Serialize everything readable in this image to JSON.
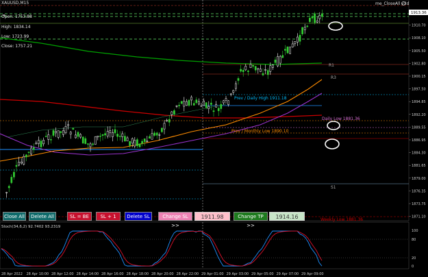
{
  "window": {
    "symbol": "XAUUSD,M15",
    "indicator_name": "me_CloseAll v3d",
    "subwindow_label": "Stoch(34,6,2) 92.7402 93.2319"
  },
  "ohlc_panel": {
    "open": "Open: 1753.88",
    "high": "High: 1834.14",
    "low": "Low: 1723.99",
    "close": "Close: 1757.21"
  },
  "toolbar": {
    "close_all": "Close All",
    "delete_all": "Delete All",
    "sl_be": "SL = BE",
    "sl_plus1": "SL + 1",
    "delete_sl": "Delete SL",
    "change_sl": "Change SL >>",
    "sl_value": "1911.98",
    "change_tp": "Change TP >>",
    "tp_value": "1914.16"
  },
  "levels": {
    "r1": "R1",
    "r3": "R3",
    "s1": "S1",
    "prev_daily_high": "Prev / Daily High 1911.18",
    "daily_low": "Daily Low 1881.36",
    "prev_monthly_low": "Prev / Monthly Low 1890.10",
    "weekly_low": "Weekly Low 1881.36"
  },
  "price_axis": [
    "1913.36",
    "1910.70",
    "1908.10",
    "1905.50",
    "1902.80",
    "1900.15",
    "1897.50",
    "1894.85",
    "1892.20",
    "1889.55",
    "1886.95",
    "1884.30",
    "1881.65",
    "1879.00",
    "1876.35",
    "1873.75",
    "1871.10"
  ],
  "current_price": "1913.36",
  "stoch_axis": [
    "100",
    "80",
    "20",
    "0"
  ],
  "time_axis": [
    "28 Apr 2022",
    "28 Apr 10:00",
    "28 Apr 12:00",
    "28 Apr 14:00",
    "28 Apr 16:00",
    "28 Apr 18:00",
    "28 Apr 20:00",
    "28 Apr 22:00",
    "29 Apr 01:00",
    "29 Apr 03:00",
    "29 Apr 05:00",
    "29 Apr 07:00",
    "29 Apr 09:00"
  ],
  "colors": {
    "bull": "#32cd32",
    "bear": "#ffffff",
    "ma_fast": "#ff8c00",
    "ma_mid": "#9932cc",
    "ma_red": "#cc0000",
    "ma_green": "#00a000",
    "daily_high": "#00bfff",
    "monthly_low": "#ff8c00",
    "daily_low": "#da70d6"
  }
}
